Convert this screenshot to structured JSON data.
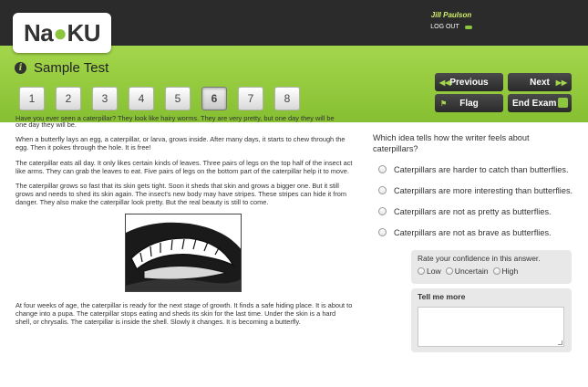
{
  "app": {
    "logo_text_left": "Na",
    "logo_text_right": "KU"
  },
  "user": {
    "name": "Jill Paulson",
    "logout_label": "LOG OUT"
  },
  "test": {
    "title": "Sample Test",
    "info_icon": "info-icon"
  },
  "question_nav": {
    "items": [
      "1",
      "2",
      "3",
      "4",
      "5",
      "6",
      "7",
      "8"
    ],
    "active": "6"
  },
  "controls": {
    "previous": "Previous",
    "next": "Next",
    "flag": "Flag",
    "end_exam": "End Exam",
    "accent": "#8cc63f"
  },
  "passage": {
    "cut_line": "Have you ever seen a caterpillar? They look like hairy worms. They are very pretty, but one day they will be",
    "lead_end": "one day they will be.",
    "p1": "When a butterfly lays an egg, a caterpillar, or larva, grows inside. After many days, it starts to chew through the egg. Then it pokes through the hole. It is free!",
    "p2": "The caterpillar eats all day. It only likes certain kinds of leaves. Three pairs of legs on the top half of the insect act like arms. They can grab the leaves to eat. Five pairs of legs on the bottom part of the caterpillar help it to move.",
    "p3": "The caterpillar grows so fast that its skin gets tight. Soon it sheds that skin and grows a bigger one. But it still grows and needs to shed its skin again. The insect's new body may have stripes. These stripes can hide it from danger. They also make the caterpillar look pretty. But the real beauty is still to come.",
    "p4": "At four weeks of age, the caterpillar is ready for the next stage of growth. It finds a safe hiding place. It is about to change into a pupa. The caterpillar stops eating and sheds its skin for the last time. Under the skin is a hard shell, or chrysalis. The caterpillar is inside the shell. Slowly it changes. It is becoming a butterfly."
  },
  "question": {
    "prompt": "Which idea tells how the writer feels about caterpillars?",
    "options": [
      "Caterpillars are harder to catch than butterflies.",
      "Caterpillars are more interesting than butterflies.",
      "Caterpillars are not as pretty as butterflies.",
      "Caterpillars are not as brave as butterflies."
    ]
  },
  "confidence": {
    "title": "Rate your confidence in this answer.",
    "options": [
      "Low",
      "Uncertain",
      "High"
    ]
  },
  "tell_me_more": {
    "title": "Tell me more",
    "value": ""
  }
}
